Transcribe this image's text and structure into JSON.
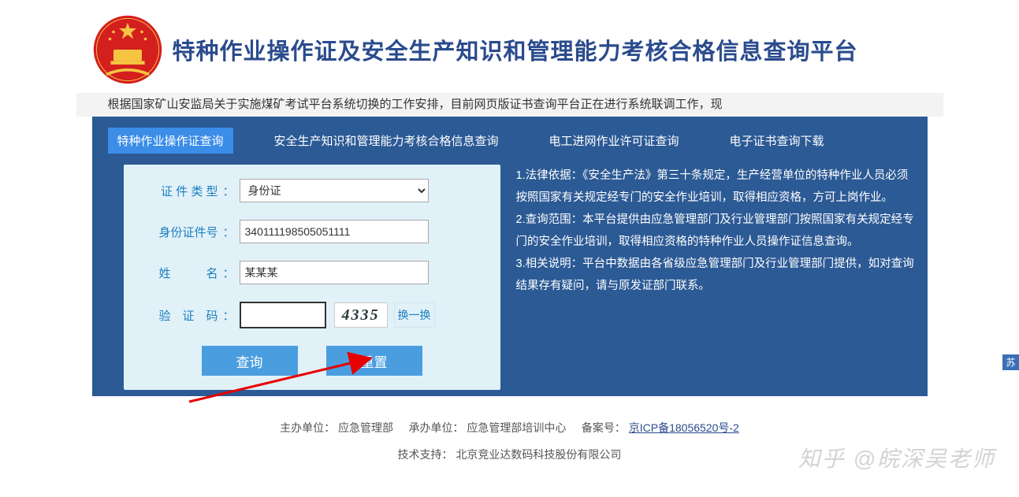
{
  "header": {
    "site_title": "特种作业操作证及安全生产知识和管理能力考核合格信息查询平台"
  },
  "marquee": {
    "text": "根据国家矿山安监局关于实施煤矿考试平台系统切换的工作安排，目前网页版证书查询平台正在进行系统联调工作，现"
  },
  "tabs": [
    {
      "label": "特种作业操作证查询",
      "active": true
    },
    {
      "label": "安全生产知识和管理能力考核合格信息查询",
      "active": false
    },
    {
      "label": "电工进网作业许可证查询",
      "active": false
    },
    {
      "label": "电子证书查询下载",
      "active": false
    }
  ],
  "form": {
    "doc_type_label": "证 件 类 型",
    "doc_type_value": "身份证",
    "id_label": "身份证件号",
    "id_value": "340111198505051111",
    "name_label": "姓　　　名",
    "name_value": "某某某",
    "captcha_label": "验　证　码",
    "captcha_value": "",
    "captcha_image_text": "4335",
    "change_captcha": "换一换",
    "submit": "查询",
    "reset": "重置"
  },
  "info": {
    "p1": "1.法律依据：《安全生产法》第三十条规定，生产经营单位的特种作业人员必须按照国家有关规定经专门的安全作业培训，取得相应资格，方可上岗作业。",
    "p2": "2.查询范围：本平台提供由应急管理部门及行业管理部门按照国家有关规定经专门的安全作业培训，取得相应资格的特种作业人员操作证信息查询。",
    "p3": "3.相关说明：平台中数据由各省级应急管理部门及行业管理部门提供，如对查询结果存有疑问，请与原发证部门联系。"
  },
  "footer": {
    "sponsor_label": "主办单位：",
    "sponsor_value": "应急管理部",
    "org_label": "承办单位：",
    "org_value": "应急管理部培训中心",
    "record_label": "备案号：",
    "record_link": "京ICP备18056520号-2",
    "tech_label": "技术支持：",
    "tech_value": "北京竞业达数码科技股份有限公司"
  },
  "watermark": "知乎 @皖深吴老师",
  "side_tag": "苏"
}
